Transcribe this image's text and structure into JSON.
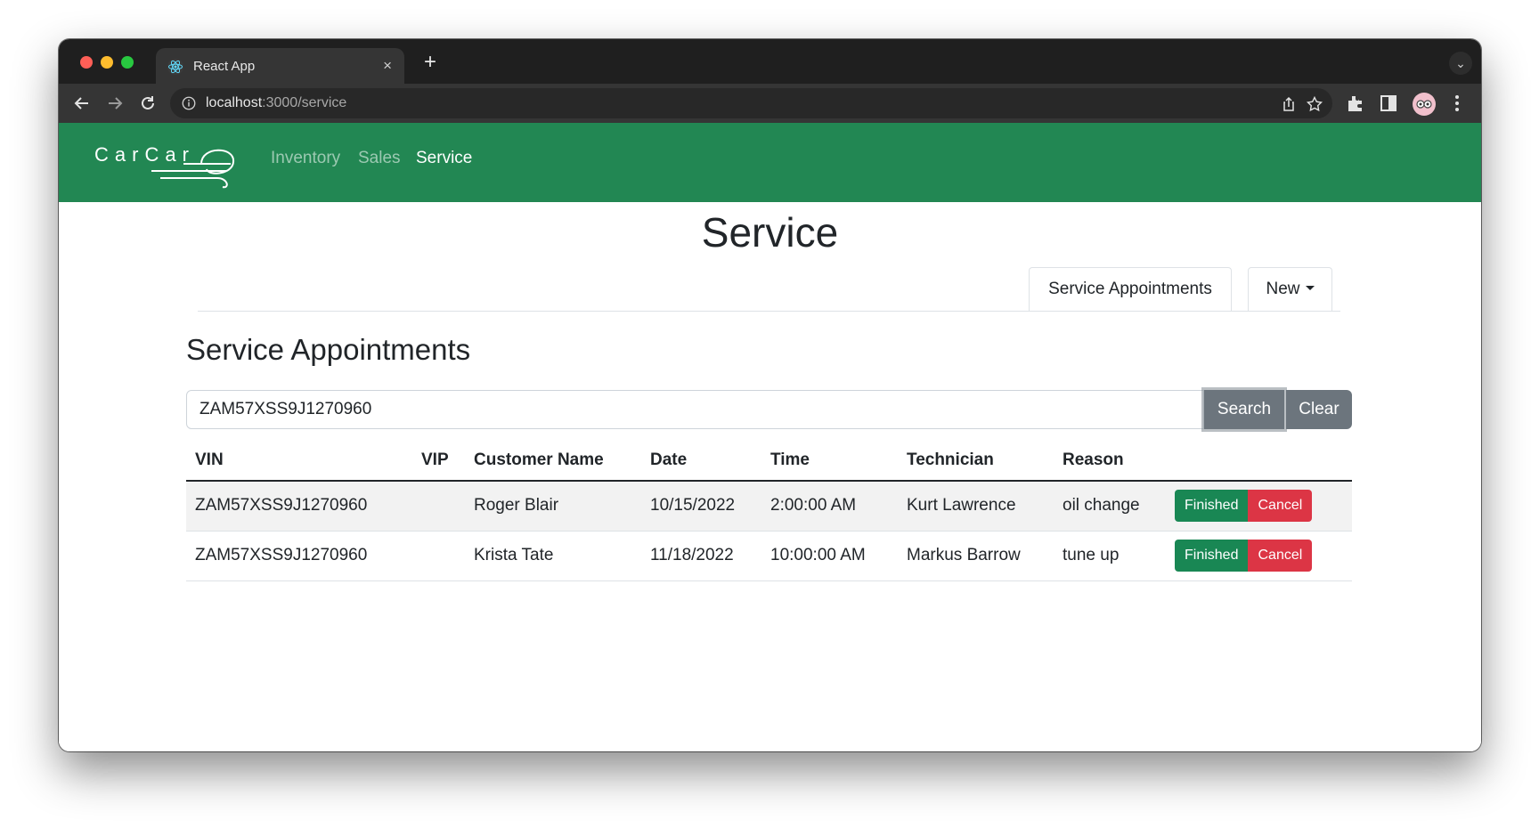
{
  "browser": {
    "tab_title": "React App",
    "tab_close": "×",
    "new_tab": "+",
    "url_host": "localhost",
    "url_path": ":3000/service"
  },
  "navbar": {
    "brand": "CarCar",
    "links": [
      {
        "label": "Inventory",
        "active": false
      },
      {
        "label": "Sales",
        "active": false
      },
      {
        "label": "Service",
        "active": true
      }
    ]
  },
  "page": {
    "title": "Service",
    "tabs": {
      "appointments_label": "Service Appointments",
      "new_label": "New"
    },
    "section_title": "Service Appointments",
    "search": {
      "value": "ZAM57XSS9J1270960",
      "search_label": "Search",
      "clear_label": "Clear"
    },
    "table": {
      "columns": [
        "VIN",
        "VIP",
        "Customer Name",
        "Date",
        "Time",
        "Technician",
        "Reason",
        ""
      ],
      "rows": [
        {
          "vin": "ZAM57XSS9J1270960",
          "vip": "",
          "customer": "Roger Blair",
          "date": "10/15/2022",
          "time": "2:00:00 AM",
          "technician": "Kurt Lawrence",
          "reason": "oil change",
          "finished_label": "Finished",
          "cancel_label": "Cancel"
        },
        {
          "vin": "ZAM57XSS9J1270960",
          "vip": "",
          "customer": "Krista Tate",
          "date": "11/18/2022",
          "time": "10:00:00 AM",
          "technician": "Markus Barrow",
          "reason": "tune up",
          "finished_label": "Finished",
          "cancel_label": "Cancel"
        }
      ]
    }
  },
  "colors": {
    "navbar": "#228753",
    "finished": "#198754",
    "cancel": "#dc3545",
    "secondary": "#6c757d"
  },
  "icons": [
    "react-favicon",
    "back-arrow-icon",
    "forward-arrow-icon",
    "reload-icon",
    "info-icon",
    "share-icon",
    "star-icon",
    "extensions-icon",
    "sidepanel-icon",
    "profile-avatar",
    "kebab-menu-icon",
    "chevron-down-icon",
    "caret-down-icon"
  ]
}
